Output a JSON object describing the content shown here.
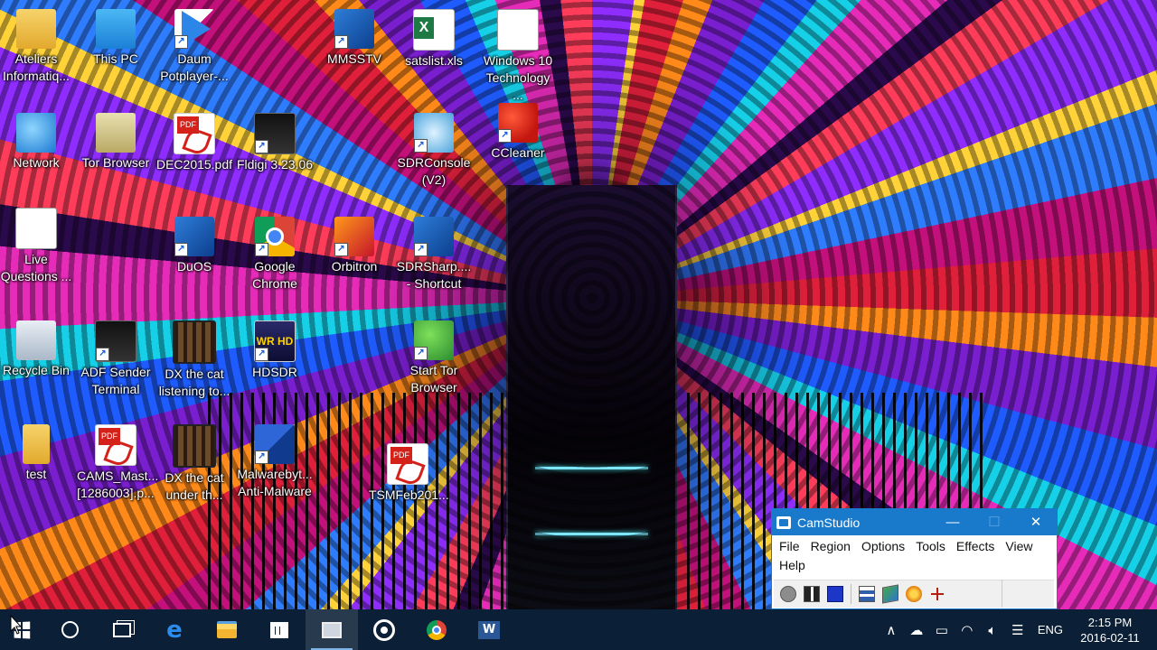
{
  "desktop": {
    "icons": [
      {
        "label": "Ateliers Informatiq...",
        "icon": "user-folder-icon"
      },
      {
        "label": "This PC",
        "icon": "computer-icon"
      },
      {
        "label": "Daum Potplayer-...",
        "icon": "media-player-icon"
      },
      {
        "label": "MMSSTV",
        "icon": "mmsstv-icon"
      },
      {
        "label": "satslist.xls",
        "icon": "excel-file-icon"
      },
      {
        "label": "Windows 10 Technology ...",
        "icon": "document-thumbnail-icon"
      },
      {
        "label": "Network",
        "icon": "network-icon"
      },
      {
        "label": "Tor Browser",
        "icon": "tor-folder-icon"
      },
      {
        "label": "DEC2015.pdf",
        "icon": "pdf-icon"
      },
      {
        "label": "Fldigi 3.23.06",
        "icon": "fldigi-icon"
      },
      {
        "label": "SDRConsole (V2)",
        "icon": "sdrconsole-icon"
      },
      {
        "label": "CCleaner",
        "icon": "ccleaner-icon"
      },
      {
        "label": "Live Questions ...",
        "icon": "document-thumbnail-icon"
      },
      {
        "label": "DuOS",
        "icon": "duos-icon"
      },
      {
        "label": "Google Chrome",
        "icon": "chrome-icon"
      },
      {
        "label": "Orbitron",
        "icon": "orbitron-icon"
      },
      {
        "label": "SDRSharp.... - Shortcut",
        "icon": "sdrsharp-icon"
      },
      {
        "label": "Recycle Bin",
        "icon": "recycle-bin-icon"
      },
      {
        "label": "ADF Sender Terminal",
        "icon": "adf-sender-icon"
      },
      {
        "label": "DX the cat listening to...",
        "icon": "video-file-icon"
      },
      {
        "label": "HDSDR",
        "icon": "hdsdr-icon"
      },
      {
        "label": "Start Tor Browser",
        "icon": "tor-globe-icon"
      },
      {
        "label": "test",
        "icon": "folder-icon"
      },
      {
        "label": "CAMS_Mast... [1286003].p...",
        "icon": "pdf-icon"
      },
      {
        "label": "DX the cat under th...",
        "icon": "video-file-icon"
      },
      {
        "label": "Malwarebyt... Anti-Malware",
        "icon": "malwarebytes-icon"
      },
      {
        "label": "TSMFeb201...",
        "icon": "pdf-icon"
      }
    ]
  },
  "camstudio": {
    "title": "CamStudio",
    "minimize": "—",
    "maximize": "☐",
    "close": "✕",
    "menu": [
      "File",
      "Region",
      "Options",
      "Tools",
      "Effects",
      "View",
      "Help"
    ],
    "toolbar": [
      "record-icon",
      "pause-icon",
      "stop-icon",
      "region-icon",
      "annotate-icon",
      "options-icon",
      "autopan-icon"
    ]
  },
  "taskbar": {
    "pinned": [
      "start-button",
      "cortana-search",
      "task-view",
      "edge",
      "file-explorer",
      "store",
      "camstudio",
      "groove-music",
      "chrome",
      "word"
    ],
    "tray": {
      "chevron": "∧",
      "language": "ENG",
      "time": "2:15 PM",
      "date": "2016-02-11"
    }
  }
}
